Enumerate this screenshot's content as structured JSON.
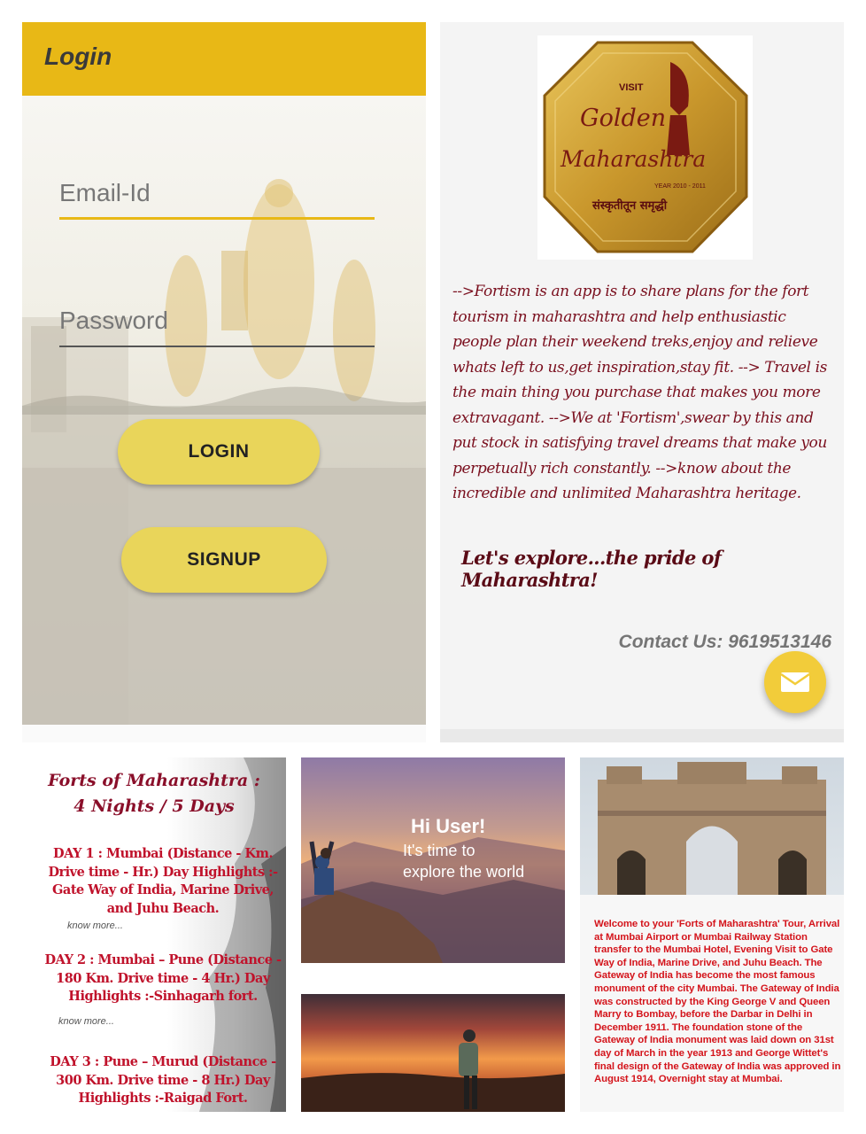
{
  "login": {
    "title": "Login",
    "email_placeholder": "Email-Id",
    "password_placeholder": "Password",
    "login_label": "LOGIN",
    "signup_label": "SIGNUP",
    "accent_color": "#e8b816",
    "button_color": "#e9d55a"
  },
  "about": {
    "logo": {
      "visit": "VISIT",
      "golden": "Golden",
      "maharashtra": "Maharashtra",
      "year": "YEAR 2010 - 2011",
      "motto": "संस्कृतीतून समृद्धी"
    },
    "description": "-->Fortism is an app is to share plans for the fort tourism in maharashtra and help enthusiastic people plan their weekend treks,enjoy and relieve whats left to us,get inspiration,stay fit. --> Travel is the main thing you purchase that makes you more extravagant. -->We at 'Fortism',swear by this and put stock in satisfying travel dreams that make you perpetually rich constantly. -->know about the incredible and unlimited Maharashtra heritage.",
    "tagline": "Let's explore...the pride of Maharashtra!",
    "contact": "Contact Us: 9619513146",
    "fab_icon": "mail-icon"
  },
  "itinerary": {
    "title_line1": "Forts of Maharashtra :",
    "title_line2": "4 Nights / 5 Days",
    "days": [
      "DAY 1 : Mumbai (Distance - Km. Drive time - Hr.) Day Highlights :-Gate Way of India, Marine Drive, and Juhu Beach.",
      "DAY 2 : Mumbai – Pune (Distance - 180 Km. Drive time - 4 Hr.) Day Highlights :-Sinhagarh fort.",
      "DAY 3 : Pune – Murud (Distance - 300 Km. Drive time - 8 Hr.) Day Highlights :-Raigad Fort."
    ],
    "know_more": "know more..."
  },
  "hero": {
    "greeting": "Hi User!",
    "line1": "It's time to",
    "line2": "explore the world"
  },
  "gateway": {
    "text": "Welcome to your 'Forts of Maharashtra' Tour, Arrival at Mumbai Airport or Mumbai Railway Station transfer to the Mumbai Hotel, Evening Visit to Gate Way of India, Marine Drive, and Juhu Beach. The Gateway of India has become the most famous monument of the city Mumbai. The Gateway of India was constructed by the King George V and Queen Marry to Bombay, before the Darbar in Delhi in December 1911. The foundation stone of the Gateway of India monument was laid down on 31st day of March in the year 1913 and George Wittet's final design of the Gateway of India was approved in August 1914, Overnight stay at Mumbai."
  }
}
